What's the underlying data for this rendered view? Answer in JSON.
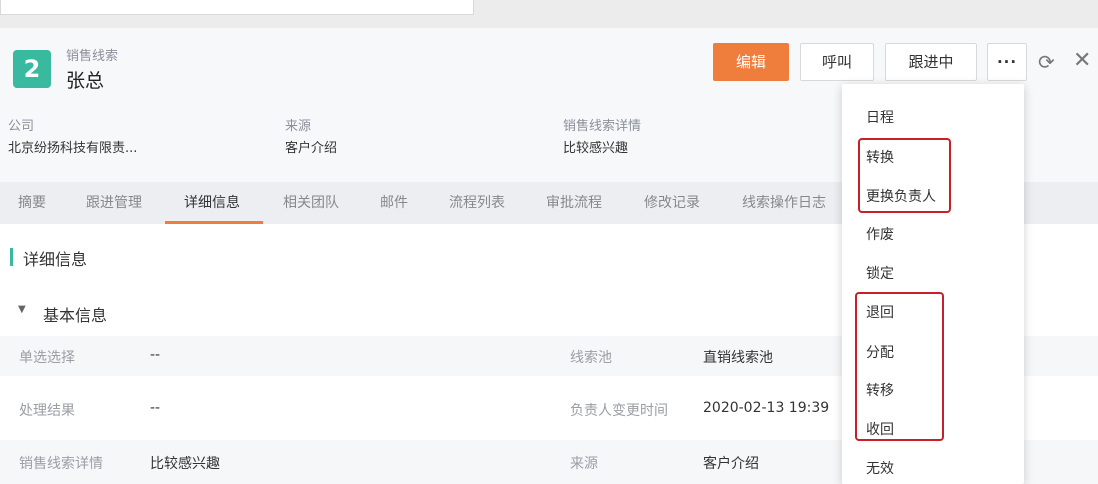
{
  "header": {
    "object_type": "销售线索",
    "record_name": "张总",
    "logo_glyph": "2",
    "accent_color": "#38b9a0",
    "primary_color": "#ef7d3c"
  },
  "actions": {
    "edit": "编辑",
    "call": "呼叫",
    "stage": "跟进中",
    "more": "···",
    "refresh_icon": "refresh-icon",
    "close_icon": "close-icon"
  },
  "summary_fields": [
    {
      "label": "公司",
      "value": "北京纷扬科技有限责..."
    },
    {
      "label": "来源",
      "value": "客户介绍"
    },
    {
      "label": "销售线索详情",
      "value": "比较感兴趣"
    }
  ],
  "tabs": [
    "摘要",
    "跟进管理",
    "详细信息",
    "相关团队",
    "邮件",
    "流程列表",
    "审批流程",
    "修改记录",
    "线索操作日志"
  ],
  "active_tab": "详细信息",
  "section": {
    "title": "详细信息",
    "group_title": "基本信息"
  },
  "rows": [
    {
      "label1": "单选选择",
      "value1": "--",
      "label2": "线索池",
      "value2": "直销线索池"
    },
    {
      "label1": "处理结果",
      "value1": "--",
      "label2": "负责人变更时间",
      "value2": "2020-02-13 19:39"
    },
    {
      "label1": "销售线索详情",
      "value1": "比较感兴趣",
      "label2": "来源",
      "value2": "客户介绍"
    }
  ],
  "more_menu": [
    "日程",
    "转换",
    "更换负责人",
    "作废",
    "锁定",
    "退回",
    "分配",
    "转移",
    "收回",
    "无效"
  ],
  "highlight_color": "#c8202a"
}
